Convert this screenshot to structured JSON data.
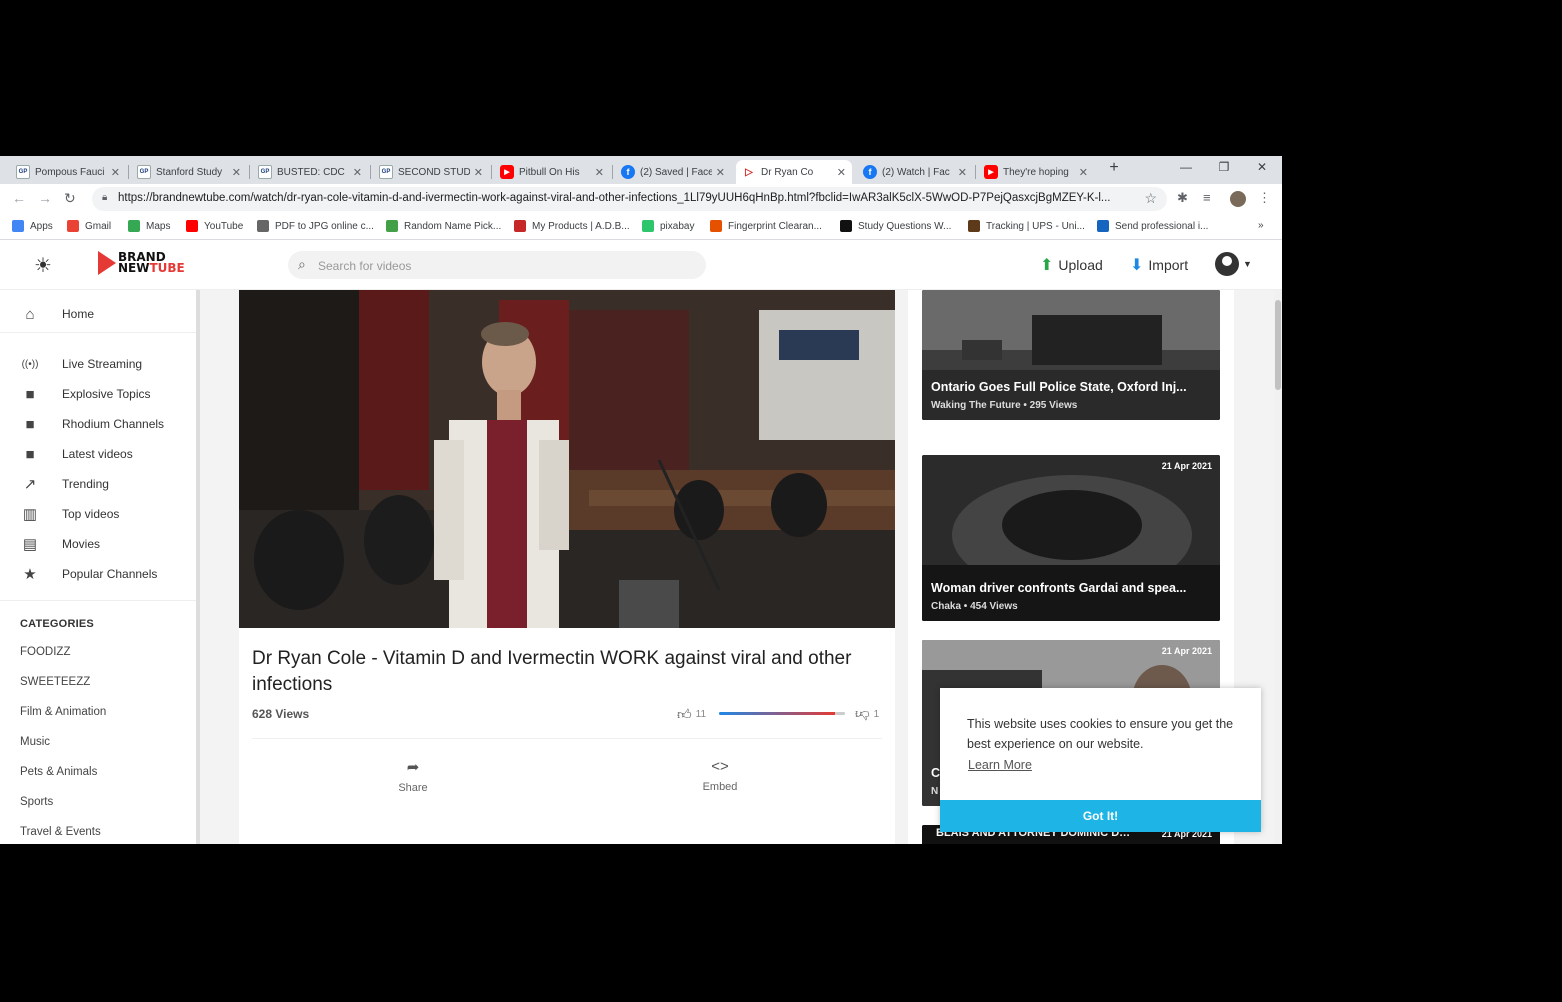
{
  "browser": {
    "tabs": [
      {
        "favicon": "GP",
        "kind": "gp",
        "title": "Pompous Fauci"
      },
      {
        "favicon": "GP",
        "kind": "gp",
        "title": "Stanford Study"
      },
      {
        "favicon": "GP",
        "kind": "gp",
        "title": "BUSTED: CDC"
      },
      {
        "favicon": "GP",
        "kind": "gp",
        "title": "SECOND STUD"
      },
      {
        "favicon": "▶",
        "kind": "yt",
        "title": "Pitbull On His"
      },
      {
        "favicon": "f",
        "kind": "fb",
        "title": "(2) Saved | Face"
      },
      {
        "favicon": "▷",
        "kind": "bnt",
        "title": "Dr Ryan Co"
      },
      {
        "favicon": "f",
        "kind": "fb",
        "title": "(2) Watch | Fac"
      },
      {
        "favicon": "▶",
        "kind": "yt",
        "title": "They're hoping"
      }
    ],
    "active_tab": 6,
    "url": "https://brandnewtube.com/watch/dr-ryan-cole-vitamin-d-and-ivermectin-work-against-viral-and-other-infections_1Ll79yUUH6qHnBp.html?fbclid=IwAR3alK5clX-5WwOD-P7PejQasxcjBgMZEY-K-l...",
    "bookmarks": [
      {
        "label": "Apps",
        "icon": "apps-grid-icon",
        "color": "#4285f4"
      },
      {
        "label": "Gmail",
        "icon": "gmail-icon",
        "color": "#ea4335"
      },
      {
        "label": "Maps",
        "icon": "maps-pin-icon",
        "color": "#34a853"
      },
      {
        "label": "YouTube",
        "icon": "youtube-icon",
        "color": "#ff0000"
      },
      {
        "label": "PDF to JPG online c...",
        "icon": "pdf-icon",
        "color": "#666666"
      },
      {
        "label": "Random Name Pick...",
        "icon": "wheel-icon",
        "color": "#43a047"
      },
      {
        "label": "My Products | A.D.B...",
        "icon": "adb-icon",
        "color": "#c62828"
      },
      {
        "label": "pixabay",
        "icon": "pixabay-icon",
        "color": "#2ec66d"
      },
      {
        "label": "Fingerprint Clearan...",
        "icon": "fingerprint-icon",
        "color": "#e65100"
      },
      {
        "label": "Study Questions W...",
        "icon": "nyt-icon",
        "color": "#111111"
      },
      {
        "label": "Tracking | UPS - Uni...",
        "icon": "ups-icon",
        "color": "#5d3a1a"
      },
      {
        "label": "Send professional i...",
        "icon": "send-icon",
        "color": "#1565c0"
      }
    ],
    "bookmarks_overflow": "»"
  },
  "site": {
    "logo_line1": "BRAND",
    "logo_line2a": "NEW",
    "logo_line2b": "TUBE",
    "search_placeholder": "Search for videos",
    "upload_label": "Upload",
    "import_label": "Import"
  },
  "sidebar": {
    "items": [
      {
        "label": "Home",
        "icon": "home-icon",
        "glyph": "⌂"
      },
      {
        "label": "Live Streaming",
        "icon": "live-stream-icon",
        "glyph": "((•))"
      },
      {
        "label": "Explosive Topics",
        "icon": "video-camera-icon",
        "glyph": "■"
      },
      {
        "label": "Rhodium Channels",
        "icon": "video-camera-icon",
        "glyph": "■"
      },
      {
        "label": "Latest videos",
        "icon": "video-camera-icon",
        "glyph": "■"
      },
      {
        "label": "Trending",
        "icon": "trending-icon",
        "glyph": "↗"
      },
      {
        "label": "Top videos",
        "icon": "bar-chart-icon",
        "glyph": "▥"
      },
      {
        "label": "Movies",
        "icon": "film-icon",
        "glyph": "▤"
      },
      {
        "label": "Popular Channels",
        "icon": "star-icon",
        "glyph": "★"
      }
    ],
    "categories_heading": "CATEGORIES",
    "categories": [
      "FOODIZZ",
      "SWEETEEZZ",
      "Film & Animation",
      "Music",
      "Pets & Animals",
      "Sports",
      "Travel & Events"
    ]
  },
  "video": {
    "title": "Dr Ryan Cole - Vitamin D and Ivermectin WORK against viral and other infections",
    "views": "628 Views",
    "likes": "11",
    "dislikes": "1",
    "like_ratio": 0.917,
    "share_label": "Share",
    "embed_label": "Embed"
  },
  "recommended": [
    {
      "title": "Ontario Goes Full Police State, Oxford Inj...",
      "meta": "Waking The Future • 295 Views",
      "date": ""
    },
    {
      "title": "Woman driver confronts Gardai and spea...",
      "meta": "Chaka • 454 Views",
      "date": "21 Apr 2021"
    },
    {
      "title": "C",
      "meta": "N",
      "date": "21 Apr 2021"
    },
    {
      "title": "BLAIS AND ATTORNEY DOMINIC DES...",
      "meta": "",
      "date": "21 Apr 2021"
    }
  ],
  "cookie": {
    "message": "This website uses cookies to ensure you get the best experience on our website.",
    "learn_more": "Learn More",
    "got_it": "Got It!"
  }
}
